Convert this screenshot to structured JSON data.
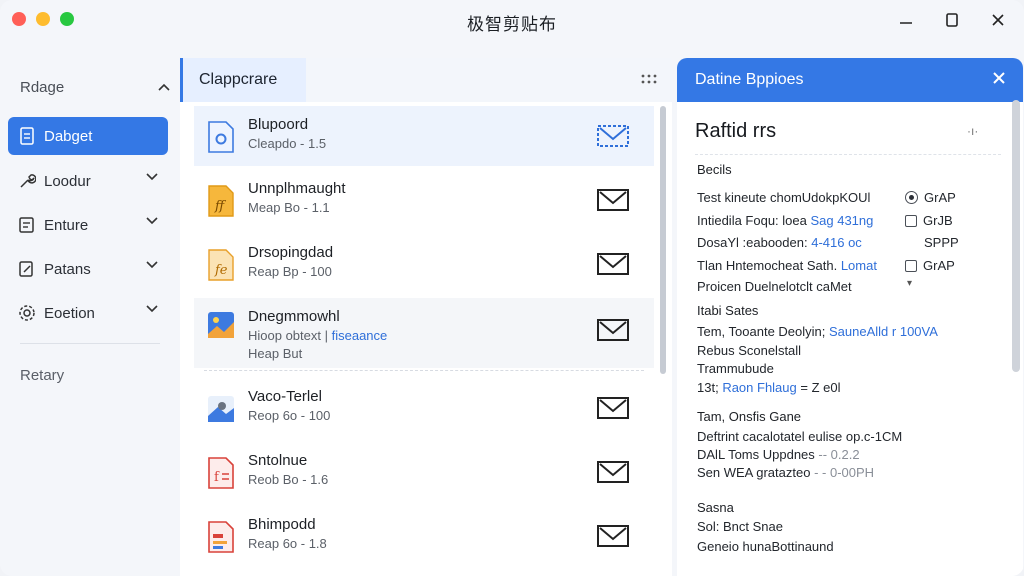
{
  "window": {
    "title": "极智剪贴布"
  },
  "sidebar": {
    "header": "Rdage",
    "items": [
      {
        "label": "Dabget",
        "icon": "document-icon",
        "active": true
      },
      {
        "label": "Loodur",
        "icon": "wrench-icon"
      },
      {
        "label": "Enture",
        "icon": "edit-box-icon"
      },
      {
        "label": "Patans",
        "icon": "document-edit-icon"
      },
      {
        "label": "Eoetion",
        "icon": "gear-icon"
      }
    ],
    "footer": "Retary"
  },
  "list": {
    "tab": "Clappcrare",
    "rows": [
      {
        "title": "Blupoord",
        "sub": "Cleapdo - 1.5",
        "icon": "blue-doc-icon"
      },
      {
        "title": "Unnplhmaught",
        "sub": "Meap Bo - 1.1",
        "icon": "orange-doc-icon"
      },
      {
        "title": "Drsopingdad",
        "sub": "Reap Bp - 100",
        "icon": "orange-doc-icon"
      },
      {
        "title": "Dnegmmowhl",
        "sub": "Hioop obtext |",
        "sub_link": "fiseaance",
        "sub2": "Heap But",
        "icon": "image-icon"
      },
      {
        "title": "Vaco-Terlel",
        "sub": "Reop 6o - 100",
        "icon": "image-icon"
      },
      {
        "title": "Sntolnue",
        "sub": "Reob Bo - 1.6",
        "icon": "red-doc-icon"
      },
      {
        "title": "Bhimpodd",
        "sub": "Reap 6o - 1.8",
        "icon": "red-doc-icon"
      }
    ]
  },
  "details": {
    "header": "Datine Bppioes",
    "title": "Raftid rrs",
    "section1": "Becils",
    "lines1": [
      {
        "text": "Test kineute chomUdokpKOUl"
      },
      {
        "text": "Intiedila Foqu: loea",
        "blue": "Sag 431ng"
      },
      {
        "text": "DosaYl :eabooden:",
        "blue": "4-416 oc"
      },
      {
        "text": "Tlan Hntemocheat Sath.",
        "blue": "Lomat"
      },
      {
        "text": "Proicen Duelnelotclt caMet"
      }
    ],
    "options": [
      {
        "label": "GrAP",
        "type": "radio"
      },
      {
        "label": "GrJB",
        "type": "checkbox"
      },
      {
        "label": "SPPP",
        "type": "text"
      },
      {
        "label": "GrAP",
        "type": "checkbox"
      }
    ],
    "section2": "Itabi Sates",
    "lines2": [
      {
        "text": "Tem, Tooante Deolyin;",
        "blue": "SauneAlld r 100VA"
      },
      {
        "text": "Rebus Sconelstall"
      },
      {
        "text": "Trammubude"
      },
      {
        "text": "13t;",
        "blue": "Raon Fhlaug",
        "tail": "= Z e0l"
      }
    ],
    "section3": "Tam, Onsfis Gane",
    "lines3": [
      {
        "text": "Deftrint cacalotatel eulise op.c-1CM"
      },
      {
        "text": "DAlL Toms Uppdnes",
        "muted": "-- 0.2.2"
      },
      {
        "text": "Sen WEA gratazteo",
        "muted": "- - 0-00PH"
      }
    ],
    "section4": "Sasna",
    "lines4": [
      {
        "text": "Sol: Bnct Snae"
      },
      {
        "text": "Geneio hunaBottinaund"
      }
    ]
  }
}
